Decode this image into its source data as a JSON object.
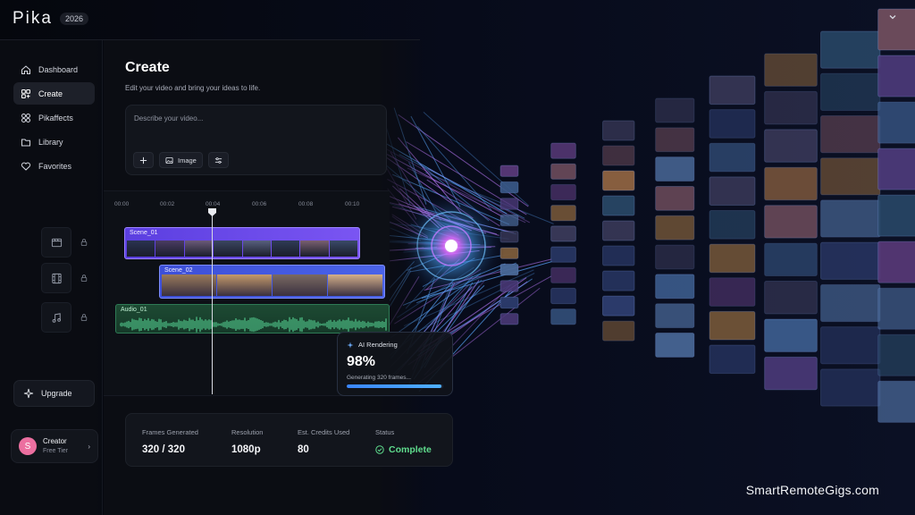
{
  "brand": {
    "name": "Pika",
    "year": "2026"
  },
  "sidebar": {
    "items": [
      {
        "label": "Dashboard",
        "icon": "home-icon"
      },
      {
        "label": "Create",
        "icon": "create-grid-icon",
        "active": true
      },
      {
        "label": "Pikaffects",
        "icon": "effects-icon"
      },
      {
        "label": "Library",
        "icon": "folder-icon"
      },
      {
        "label": "Favorites",
        "icon": "heart-icon"
      }
    ],
    "upgrade_label": "Upgrade",
    "user": {
      "initial": "S",
      "name": "Creator",
      "tier": "Free Tier"
    }
  },
  "main": {
    "title": "Create",
    "subtitle": "Edit your video and bring your ideas to life.",
    "prompt": {
      "placeholder": "Describe your video...",
      "image_button": "Image"
    }
  },
  "timeline": {
    "ticks": [
      "00:00",
      "00:02",
      "00:04",
      "00:06",
      "00:08",
      "00:10"
    ],
    "playhead_time": "00:04",
    "clips": [
      {
        "label": "Scene_01",
        "type": "video"
      },
      {
        "label": "Scene_02",
        "type": "video"
      },
      {
        "label": "Audio_01",
        "type": "audio"
      }
    ]
  },
  "render": {
    "title": "AI Rendering",
    "percent_text": "98%",
    "progress": 0.98,
    "detail": "Generating 320 frames..."
  },
  "stats": [
    {
      "label": "Frames Generated",
      "value": "320 / 320"
    },
    {
      "label": "Resolution",
      "value": "1080p"
    },
    {
      "label": "Est. Credits Used",
      "value": "80"
    },
    {
      "label": "Status",
      "value": "Complete"
    }
  ],
  "watermark": "SmartRemoteGigs.com",
  "colors": {
    "accent_purple": "#6b4ff0",
    "accent_blue": "#3a86ff",
    "status_green": "#5fdc8d",
    "audio_green": "#2e7a55"
  }
}
